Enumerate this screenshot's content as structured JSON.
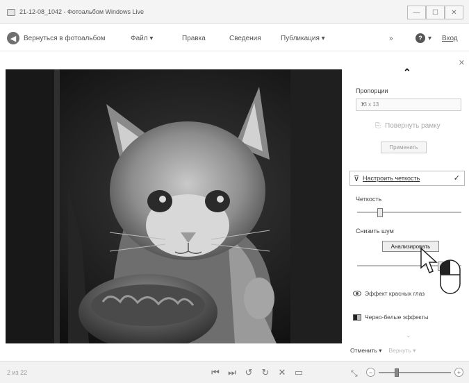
{
  "window": {
    "title": "21-12-08_1042 - Фотоальбом Windows Live",
    "minimize": "—",
    "maximize": "☐",
    "close": "✕"
  },
  "toolbar": {
    "back_label": "Вернуться в фотоальбом",
    "file_menu": "Файл ▾",
    "fix_label": "Правка",
    "info_label": "Сведения",
    "publish_menu": "Публикация ▾",
    "overflow": "»",
    "help": "?",
    "help_caret": "▾",
    "signin": "Вход"
  },
  "panel": {
    "close": "✕",
    "collapse_up": "⌃",
    "proportion_label": "Пропорции",
    "proportion_value": "13 x 13",
    "rotate_label": "Повернуть рамку",
    "apply_label": "Применить",
    "sharpness_section": "Настроить четкость",
    "sharpness_label": "Четкость",
    "sharpness_level": 0.22,
    "denoise_label": "Снизить шум",
    "analyze_button": "Анализировать",
    "denoise_level": 0.8,
    "redeye_label": "Эффект красных глаз",
    "bw_label": "Черно-белые эффекты",
    "expand_down": "⌄",
    "undo_label": "Отменить ▾",
    "redo_label": "Вернуть ▾"
  },
  "status": {
    "position": "2 из 22",
    "prev": "⏮",
    "next": "⏭",
    "rotate_left": "↺",
    "rotate_right": "↻",
    "delete": "✕",
    "slideshow": "▭",
    "fit": "⤡",
    "zoom_minus": "−",
    "zoom_plus": "+",
    "zoom_level": 0.25
  }
}
